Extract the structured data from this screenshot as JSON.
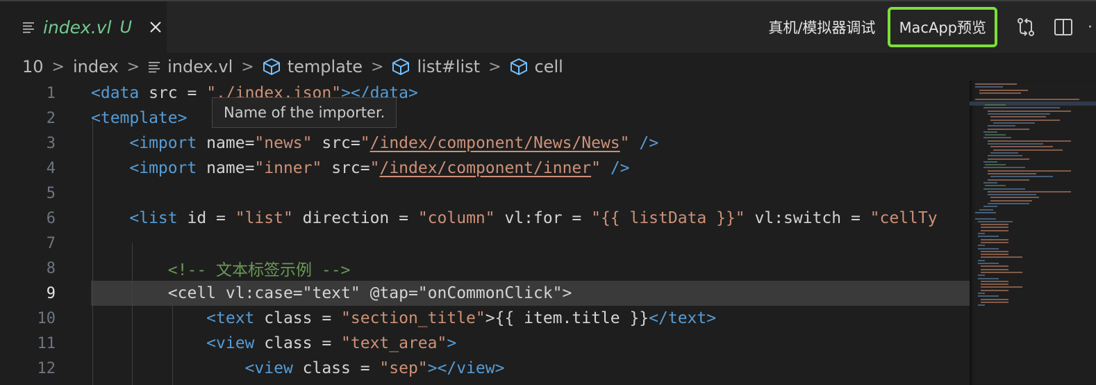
{
  "tab": {
    "title": "index.vl",
    "badge": "U",
    "file_icon": "lines-file-icon",
    "close_icon": "close-icon"
  },
  "actions": {
    "debug_label": "真机/模拟器调试",
    "macapp_label": "MacApp预览",
    "compare_icon": "source-control-compare-icon",
    "split_icon": "split-editor-icon",
    "more_icon": "more-icon",
    "highlight_color": "#7cdf3a"
  },
  "breadcrumb": {
    "items": [
      "10",
      "index",
      "index.vl",
      "template",
      "list#list",
      "cell"
    ],
    "separator": ">"
  },
  "tooltip": {
    "text": "Name of the importer."
  },
  "editor": {
    "active_line": "9",
    "lines": [
      {
        "no": "1",
        "tokens": [
          {
            "t": "<data",
            "c": "tag"
          },
          {
            "t": " src = ",
            "c": "attr"
          },
          {
            "t": "\"./index.json\"",
            "c": "str"
          },
          {
            "t": "></",
            "c": "tag"
          },
          {
            "t": "data",
            "c": "tag"
          },
          {
            "t": ">",
            "c": "tag"
          }
        ]
      },
      {
        "no": "2",
        "tokens": [
          {
            "t": "<template>",
            "c": "tag"
          }
        ]
      },
      {
        "no": "3",
        "tokens": [
          {
            "t": "    <import",
            "c": "tag"
          },
          {
            "t": " name=",
            "c": "attr"
          },
          {
            "t": "\"news\"",
            "c": "str"
          },
          {
            "t": " src=",
            "c": "attr"
          },
          {
            "t": "\"",
            "c": "str"
          },
          {
            "t": "/index/component/News/News",
            "c": "link"
          },
          {
            "t": "\"",
            "c": "str"
          },
          {
            "t": " />",
            "c": "tag"
          }
        ]
      },
      {
        "no": "4",
        "tokens": [
          {
            "t": "    <import",
            "c": "tag"
          },
          {
            "t": " name=",
            "c": "attr"
          },
          {
            "t": "\"inner\"",
            "c": "str"
          },
          {
            "t": " src=",
            "c": "attr"
          },
          {
            "t": "\"",
            "c": "str"
          },
          {
            "t": "/index/component/inner",
            "c": "link"
          },
          {
            "t": "\"",
            "c": "str"
          },
          {
            "t": " />",
            "c": "tag"
          }
        ]
      },
      {
        "no": "5",
        "tokens": []
      },
      {
        "no": "6",
        "tokens": [
          {
            "t": "    <list",
            "c": "tag"
          },
          {
            "t": " id = ",
            "c": "attr"
          },
          {
            "t": "\"list\"",
            "c": "str"
          },
          {
            "t": " direction = ",
            "c": "attr"
          },
          {
            "t": "\"column\"",
            "c": "str"
          },
          {
            "t": " vl:for = ",
            "c": "attr"
          },
          {
            "t": "\"{{ listData }}\"",
            "c": "str"
          },
          {
            "t": " vl:switch = ",
            "c": "attr"
          },
          {
            "t": "\"cellTy",
            "c": "str"
          }
        ]
      },
      {
        "no": "7",
        "tokens": []
      },
      {
        "no": "8",
        "tokens": [
          {
            "t": "        <!-- 文本标签示例 -->",
            "c": "comment"
          }
        ]
      },
      {
        "no": "9",
        "tokens": [
          {
            "t": "        <cell vl:case=\"text\" @tap=\"onCommonClick\">",
            "c": "attr"
          }
        ]
      },
      {
        "no": "10",
        "tokens": [
          {
            "t": "            <text",
            "c": "tag"
          },
          {
            "t": " class = ",
            "c": "attr"
          },
          {
            "t": "\"section_title\"",
            "c": "str"
          },
          {
            "t": ">{{ item.title }}",
            "c": "attr"
          },
          {
            "t": "</text>",
            "c": "tag"
          }
        ]
      },
      {
        "no": "11",
        "tokens": [
          {
            "t": "            <view",
            "c": "tag"
          },
          {
            "t": " class = ",
            "c": "attr"
          },
          {
            "t": "\"text_area\"",
            "c": "str"
          },
          {
            "t": ">",
            "c": "tag"
          }
        ]
      },
      {
        "no": "12",
        "tokens": [
          {
            "t": "                <view",
            "c": "tag"
          },
          {
            "t": " class = ",
            "c": "attr"
          },
          {
            "t": "\"sep\"",
            "c": "str"
          },
          {
            "t": "></view>",
            "c": "tag"
          }
        ]
      }
    ]
  },
  "colors": {
    "tag": "#569cd6",
    "string": "#ce9178",
    "comment": "#6a9955",
    "modified_tab": "#73c991"
  }
}
